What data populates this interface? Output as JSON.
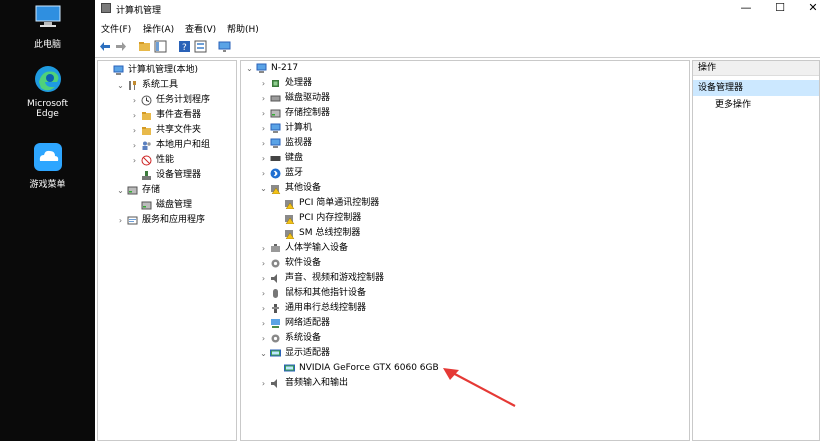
{
  "desktop": {
    "icons": [
      {
        "label": "此电脑"
      },
      {
        "label": "Microsoft Edge"
      },
      {
        "label": "游戏菜单"
      }
    ]
  },
  "window": {
    "title": "计算机管理",
    "controls": {
      "minimize": "—",
      "maximize": "☐",
      "close": "✕"
    }
  },
  "menu": [
    "文件(F)",
    "操作(A)",
    "查看(V)",
    "帮助(H)"
  ],
  "left_tree": [
    {
      "label": "计算机管理(本地)",
      "level": 0,
      "arrow": ""
    },
    {
      "label": "系统工具",
      "level": 1,
      "arrow": "⌄"
    },
    {
      "label": "任务计划程序",
      "level": 2,
      "arrow": "›"
    },
    {
      "label": "事件查看器",
      "level": 2,
      "arrow": "›"
    },
    {
      "label": "共享文件夹",
      "level": 2,
      "arrow": "›"
    },
    {
      "label": "本地用户和组",
      "level": 2,
      "arrow": "›"
    },
    {
      "label": "性能",
      "level": 2,
      "arrow": "›"
    },
    {
      "label": "设备管理器",
      "level": 2,
      "arrow": "",
      "selected": true
    },
    {
      "label": "存储",
      "level": 1,
      "arrow": "⌄"
    },
    {
      "label": "磁盘管理",
      "level": 2,
      "arrow": ""
    },
    {
      "label": "服务和应用程序",
      "level": 1,
      "arrow": "›"
    }
  ],
  "device_tree": [
    {
      "label": "N-217",
      "level": 0,
      "arrow": "⌄"
    },
    {
      "label": "处理器",
      "level": 1,
      "arrow": "›"
    },
    {
      "label": "磁盘驱动器",
      "level": 1,
      "arrow": "›"
    },
    {
      "label": "存储控制器",
      "level": 1,
      "arrow": "›"
    },
    {
      "label": "计算机",
      "level": 1,
      "arrow": "›"
    },
    {
      "label": "监视器",
      "level": 1,
      "arrow": "›"
    },
    {
      "label": "键盘",
      "level": 1,
      "arrow": "›"
    },
    {
      "label": "蓝牙",
      "level": 1,
      "arrow": "›"
    },
    {
      "label": "其他设备",
      "level": 1,
      "arrow": "⌄"
    },
    {
      "label": "PCI 简单通讯控制器",
      "level": 2,
      "arrow": ""
    },
    {
      "label": "PCI 内存控制器",
      "level": 2,
      "arrow": ""
    },
    {
      "label": "SM 总线控制器",
      "level": 2,
      "arrow": ""
    },
    {
      "label": "人体学输入设备",
      "level": 1,
      "arrow": "›"
    },
    {
      "label": "软件设备",
      "level": 1,
      "arrow": "›"
    },
    {
      "label": "声音、视频和游戏控制器",
      "level": 1,
      "arrow": "›"
    },
    {
      "label": "鼠标和其他指针设备",
      "level": 1,
      "arrow": "›"
    },
    {
      "label": "通用串行总线控制器",
      "level": 1,
      "arrow": "›"
    },
    {
      "label": "网络适配器",
      "level": 1,
      "arrow": "›"
    },
    {
      "label": "系统设备",
      "level": 1,
      "arrow": "›"
    },
    {
      "label": "显示适配器",
      "level": 1,
      "arrow": "⌄"
    },
    {
      "label": "NVIDIA GeForce GTX 6060 6GB",
      "level": 2,
      "arrow": ""
    },
    {
      "label": "音频输入和输出",
      "level": 1,
      "arrow": "›"
    }
  ],
  "actions": {
    "header": "操作",
    "group": "设备管理器",
    "more": "更多操作"
  },
  "colors": {
    "annotation_arrow": "#e53935",
    "selection": "#cce8ff"
  }
}
